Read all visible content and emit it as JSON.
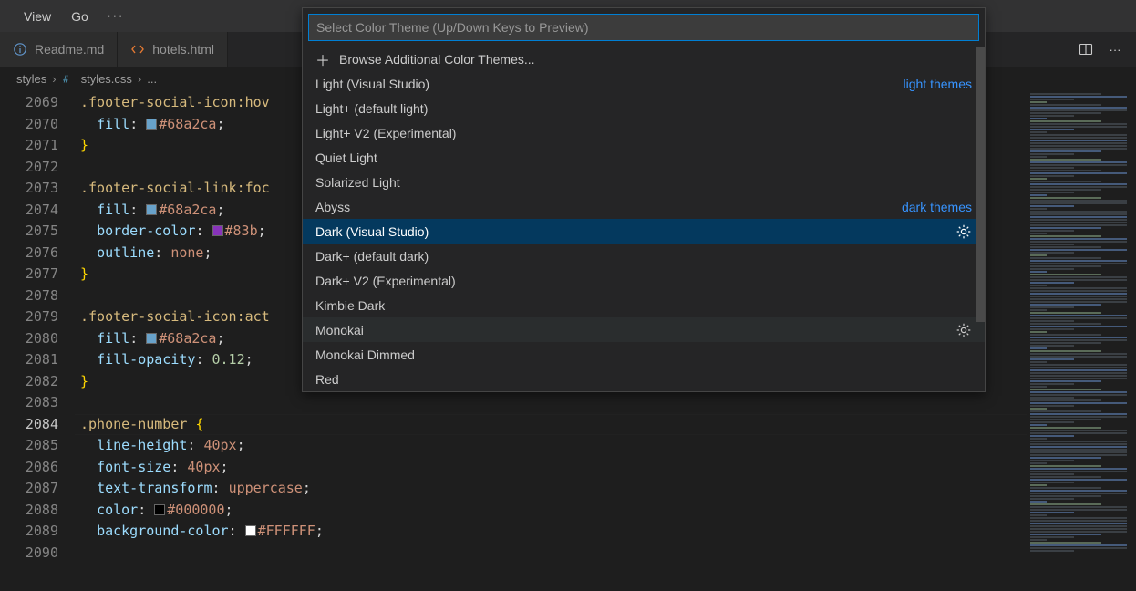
{
  "menubar": {
    "view": "View",
    "go": "Go"
  },
  "tabs": {
    "readme_label": "Readme.md",
    "hotels_label": "hotels.html"
  },
  "tab_actions": {
    "split": "",
    "more": ""
  },
  "breadcrumbs": {
    "folder": "styles",
    "file": "styles.css",
    "trail": "..."
  },
  "gutter": {
    "start": 2069,
    "count": 22,
    "current": 2084
  },
  "code": {
    "l2069_sel": ".footer-social-icon:hov",
    "l2070_prop": "fill",
    "l2070_val": "#68a2ca",
    "l2073_sel": ".footer-social-link:foc",
    "l2074_prop": "fill",
    "l2074_val": "#68a2ca",
    "l2075_prop": "border-color",
    "l2075_val": "#83b",
    "l2076_prop": "outline",
    "l2076_val": "none",
    "l2080_sel": ".footer-social-icon:act",
    "l2081_prop": "fill",
    "l2081_val": "#68a2ca",
    "l2082_prop": "fill-opacity",
    "l2082_val": "0.12",
    "l2085_sel": ".phone-number",
    "l2086_prop": "line-height",
    "l2086_val": "40px",
    "l2087_prop": "font-size",
    "l2087_val": "40px",
    "l2088_prop": "text-transform",
    "l2088_val": "uppercase",
    "l2089_prop": "color",
    "l2089_val": "#000000",
    "l2090_prop": "background-color",
    "l2090_val": "#FFFFFF"
  },
  "quickpick": {
    "placeholder": "Select Color Theme (Up/Down Keys to Preview)",
    "browse": "Browse Additional Color Themes...",
    "light_cat": "light themes",
    "dark_cat": "dark themes",
    "items": {
      "light_vs": "Light (Visual Studio)",
      "light_plus": "Light+ (default light)",
      "light_v2": "Light+ V2 (Experimental)",
      "quiet": "Quiet Light",
      "solarized": "Solarized Light",
      "abyss": "Abyss",
      "dark_vs": "Dark (Visual Studio)",
      "dark_plus": "Dark+ (default dark)",
      "dark_v2": "Dark+ V2 (Experimental)",
      "kimbie": "Kimbie Dark",
      "monokai": "Monokai",
      "monokai_dim": "Monokai Dimmed",
      "red": "Red"
    }
  }
}
